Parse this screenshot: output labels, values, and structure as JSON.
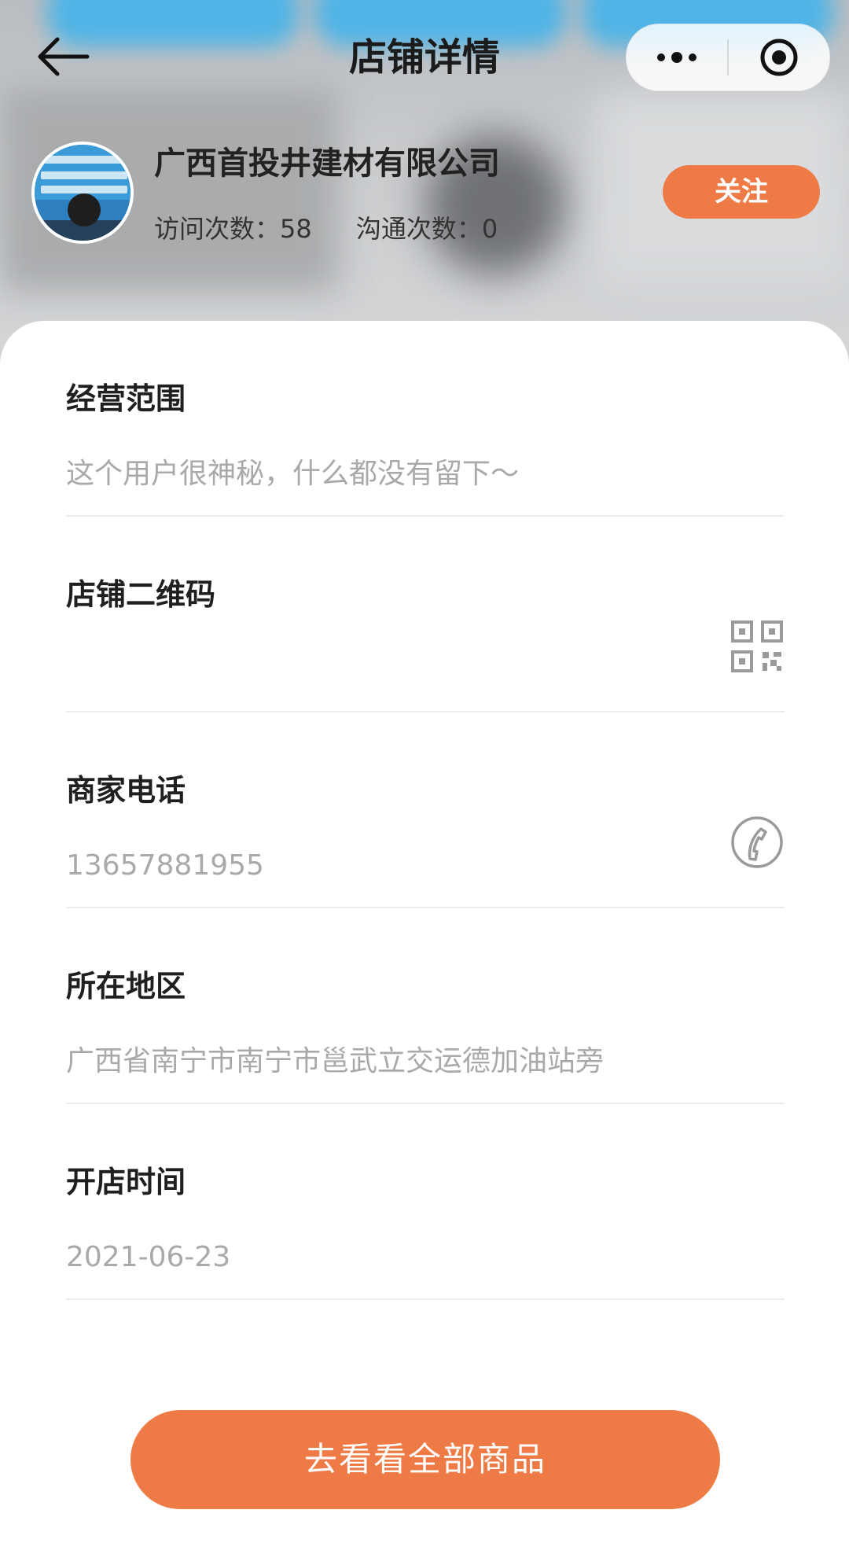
{
  "nav": {
    "title": "店铺详情",
    "back_icon": "arrow-left-icon",
    "more_icon": "more-dots-icon",
    "close_icon": "target-circle-icon"
  },
  "shop": {
    "name": "广西首投井建材有限公司",
    "visits_label": "访问次数：58",
    "chats_label": "沟通次数：0",
    "follow_label": "关注"
  },
  "sections": {
    "scope": {
      "title": "经营范围",
      "value": "这个用户很神秘，什么都没有留下～"
    },
    "qrcode": {
      "title": "店铺二维码",
      "icon": "qr-code-icon"
    },
    "phone": {
      "title": "商家电话",
      "value": "13657881955",
      "icon": "phone-icon"
    },
    "region": {
      "title": "所在地区",
      "value": "广西省南宁市南宁市邕武立交运德加油站旁"
    },
    "opened": {
      "title": "开店时间",
      "value": "2021-06-23"
    }
  },
  "cta": {
    "label": "去看看全部商品"
  },
  "colors": {
    "accent": "#ee7a45",
    "value_text": "#a9a9a9",
    "divider": "#ececec"
  }
}
